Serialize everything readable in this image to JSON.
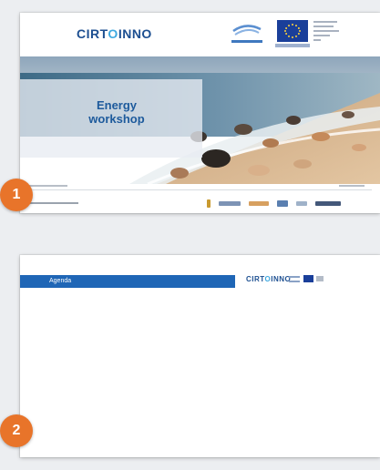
{
  "slides": [
    {
      "number": "1",
      "logo": {
        "part1": "CIRT",
        "part2": "O",
        "part3": "INNO"
      },
      "title_line1": "Energy",
      "title_line2": "workshop"
    },
    {
      "number": "2",
      "bar_label": "Agenda",
      "logo": {
        "part1": "CIRT",
        "part2": "O",
        "part3": "INNO"
      }
    }
  ],
  "colors": {
    "badge": "#e8742a",
    "brand_blue": "#1d4f91",
    "brand_light": "#3fa9e0",
    "agenda_bar": "#1f66b6",
    "eu_blue": "#1a3f9a"
  },
  "icons": [
    "interreg-logo-icon",
    "eu-flag-icon"
  ]
}
